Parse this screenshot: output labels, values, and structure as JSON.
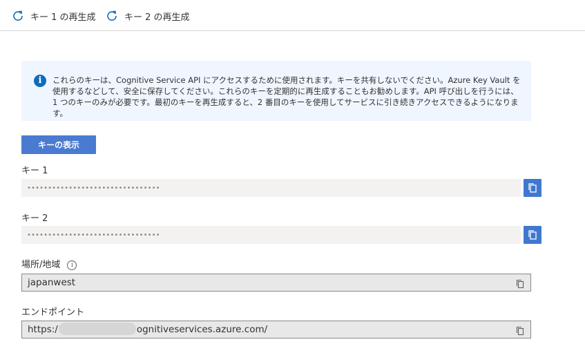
{
  "toolbar": {
    "regen_key1_label": "キー 1 の再生成",
    "regen_key2_label": "キー 2 の再生成",
    "icon": "refresh-icon"
  },
  "info": {
    "icon": "info-icon",
    "text": "これらのキーは、Cognitive Service API にアクセスするために使用されます。キーを共有しないでください。Azure Key Vault を使用するなどして、安全に保存してください。これらのキーを定期的に再生成することもお勧めします。API 呼び出しを行うには、1 つのキーのみが必要です。最初のキーを再生成すると、2 番目のキーを使用してサービスに引き続きアクセスできるようになります。"
  },
  "show_keys_label": "キーの表示",
  "key1": {
    "label": "キー 1",
    "value": "••••••••••••••••••••••••••••••••"
  },
  "key2": {
    "label": "キー 2",
    "value": "••••••••••••••••••••••••••••••••"
  },
  "location": {
    "label": "場所/地域",
    "value": "japanwest"
  },
  "endpoint": {
    "label": "エンドポイント",
    "prefix": "https:/",
    "suffix": "ognitiveservices.azure.com/"
  },
  "colors": {
    "accent": "#4a7bd0",
    "info_bg": "#f0f6ff",
    "field_bg": "#f3f2f1"
  }
}
